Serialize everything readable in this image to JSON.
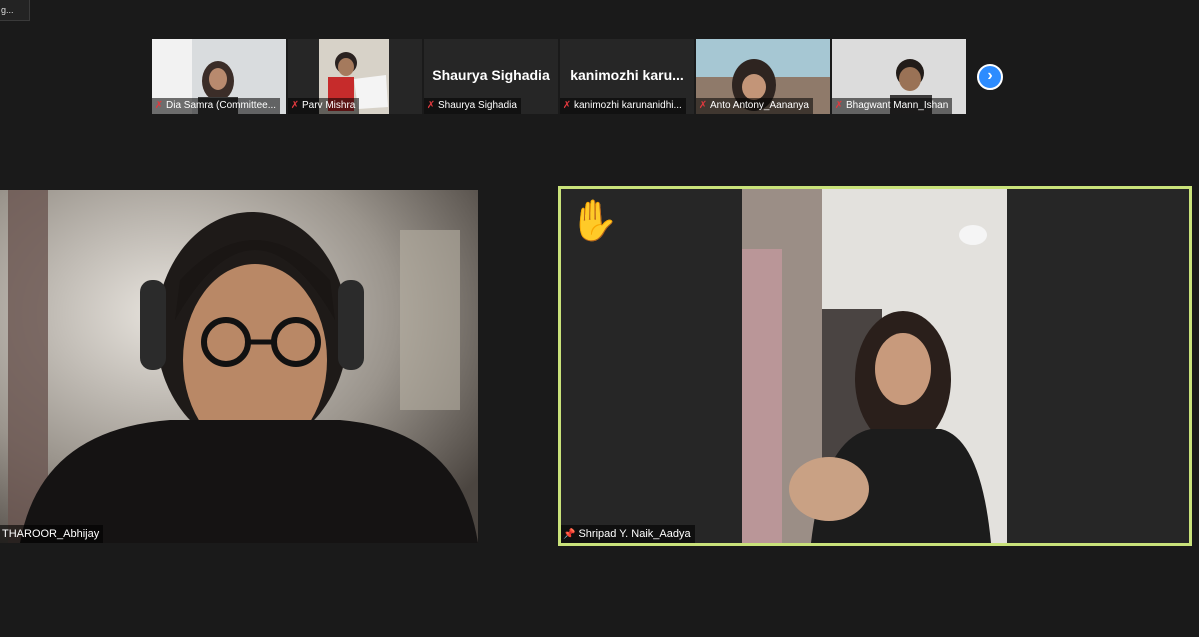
{
  "window": {
    "corner_label": "g..."
  },
  "strip": {
    "participants": [
      {
        "name": "Dia Samra (Committee...",
        "big_name": ""
      },
      {
        "name": "Parv Mishra",
        "big_name": ""
      },
      {
        "name": "Shaurya Sighadia",
        "big_name": "Shaurya Sighadia"
      },
      {
        "name": "kanimozhi karunanidhi...",
        "big_name": "kanimozhi karu..."
      },
      {
        "name": "Anto Antony_Aananya",
        "big_name": ""
      },
      {
        "name": "Bhagwant Mann_Ishan",
        "big_name": ""
      }
    ],
    "mic_icon": "mic-muted-icon",
    "next_icon": "chevron-right-icon",
    "next_glyph": "›"
  },
  "speaker_view": {
    "left": {
      "name": "THAROOR_Abhijay"
    },
    "right": {
      "name": "Shripad Y. Naik_Aadya",
      "pin_glyph": "📌",
      "hand_glyph": "✋",
      "highlight_color": "#c9e27a"
    }
  }
}
